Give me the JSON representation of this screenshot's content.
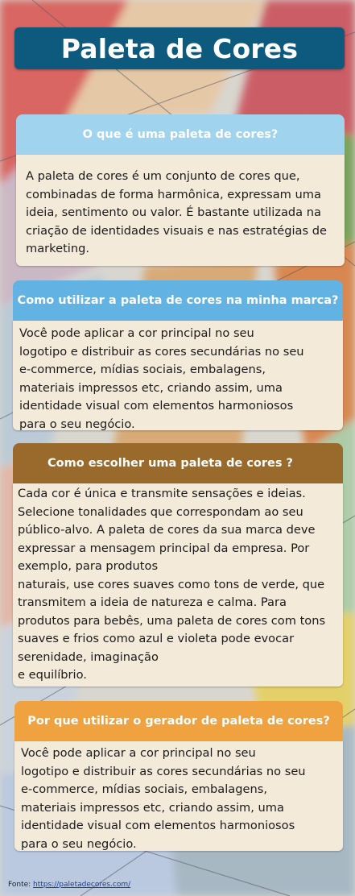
{
  "title": "Paleta de Cores",
  "sections": [
    {
      "heading": "O que é uma paleta de cores?",
      "body": "A paleta de cores é um conjunto de cores que, combinadas de forma harmônica, expressam uma ideia, sentimento ou valor. É bastante utilizada na criação de identidades visuais e nas estratégias de marketing.",
      "color": "#9fd3ee"
    },
    {
      "heading": "Como utilizar a paleta de cores na minha marca?",
      "body": "Você pode aplicar a cor principal no seu\nlogotipo e distribuir as cores secundárias no seu\ne-commerce, mídias sociais, embalagens,\nmateriais impressos etc, criando assim, uma\nidentidade visual com elementos harmoniosos\npara o seu negócio.",
      "color": "#62b3e3"
    },
    {
      "heading": "Como escolher uma paleta de cores ?",
      "body": "Cada cor é única e transmite sensações e ideias.\nSelecione tonalidades que correspondam ao seu\npúblico-alvo. A paleta de cores da sua marca deve\nexpressar a mensagem principal da empresa. Por\nexemplo, para produtos\nnaturais, use cores suaves como tons de verde, que\ntransmitem a ideia de natureza e calma. Para\nprodutos para bebês, uma paleta de cores com tons\nsuaves e frios como azul e violeta pode evocar\nserenidade, imaginação\ne equilíbrio.",
      "color": "#9a6a2c"
    },
    {
      "heading": "Por que utilizar o gerador de paleta de cores?",
      "body": "Você pode aplicar a cor principal no seu\nlogotipo e distribuir as cores secundárias no seu\ne-commerce, mídias sociais, embalagens,\nmateriais impressos etc, criando assim, uma\nidentidade visual com elementos harmoniosos\npara o seu negócio.",
      "color": "#efa23f"
    }
  ],
  "source": {
    "label": "Fonte:",
    "link_text": "https://paletadecores.com/"
  },
  "colors": {
    "title_bar": "#0d5a7e",
    "card_body": "#f3ead9"
  }
}
